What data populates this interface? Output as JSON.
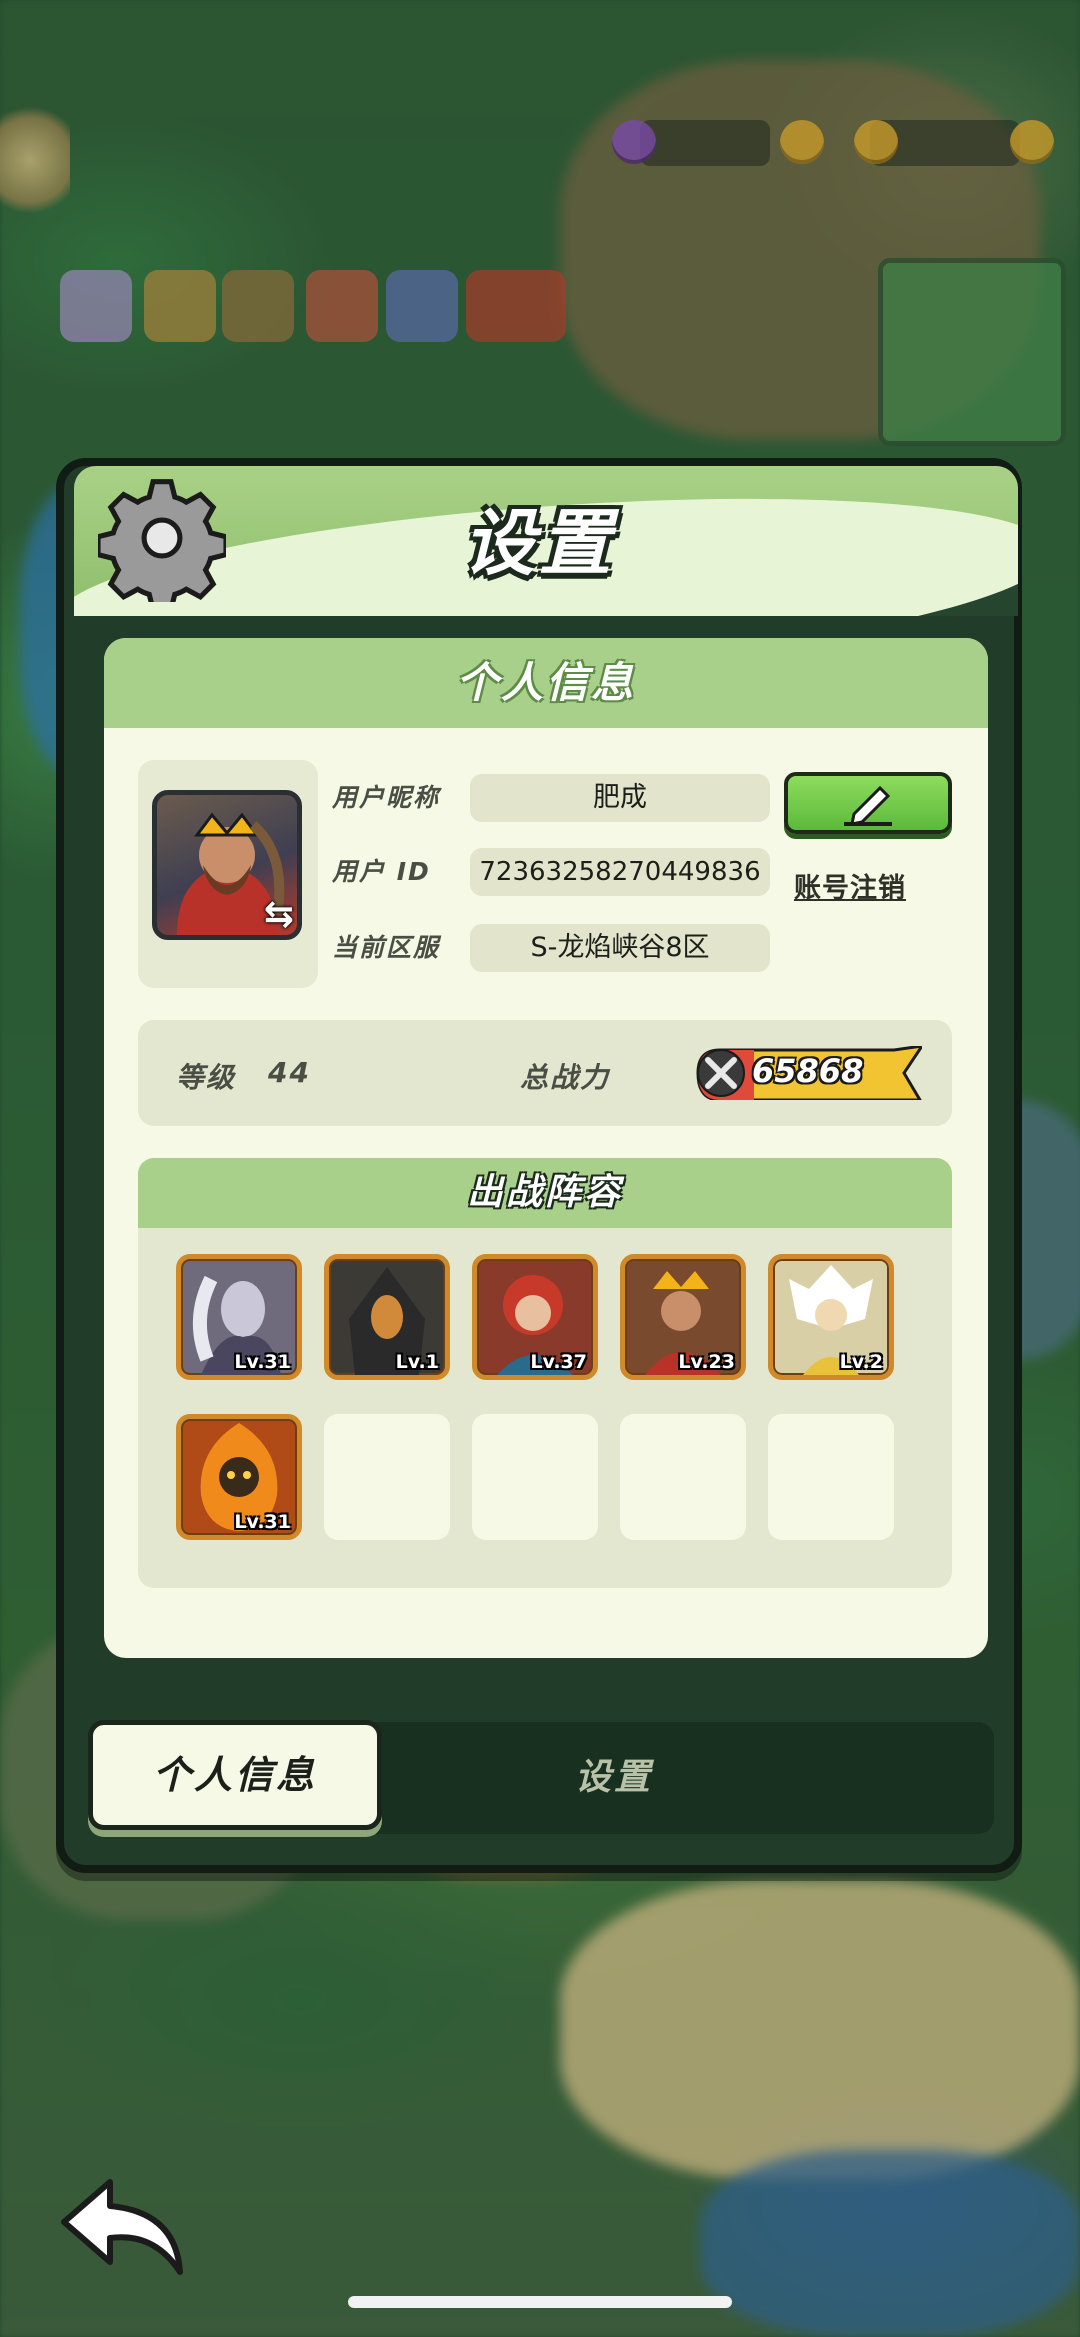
{
  "dialog": {
    "title": "设置",
    "profile_header": "个人信息",
    "labels": {
      "nickname": "用户昵称",
      "user_id": "用户 ID",
      "server": "当前区服"
    },
    "values": {
      "nickname": "肥成",
      "user_id": "7236325827044983­6",
      "server": "S-龙焰峡谷8区"
    },
    "cancel_account": "账号注销",
    "level_label": "等级",
    "level_value": "44",
    "power_label": "总战力",
    "power_value": "65868",
    "lineup_header": "出战阵容",
    "heroes": [
      {
        "level": "Lv.31",
        "color": "#6f6b7c"
      },
      {
        "level": "Lv.1",
        "color": "#3b3a35"
      },
      {
        "level": "Lv.37",
        "color": "#8a3a2a"
      },
      {
        "level": "Lv.23",
        "color": "#7a4a2e"
      },
      {
        "level": "Lv.2",
        "color": "#d9cfa6"
      },
      {
        "level": "Lv.31",
        "color": "#b04a16"
      }
    ]
  },
  "tabs": {
    "profile": "个人信息",
    "settings": "设置"
  },
  "icons": {
    "settings": "gear-icon",
    "edit": "pencil-icon",
    "swap": "swap-icon",
    "power": "crossed-swords-icon",
    "back": "back-arrow-icon"
  },
  "colors": {
    "accent_green": "#8ebe6c",
    "panel_bg": "#213d2a",
    "card_bg": "#f6f9e6",
    "power_badge": "#f2c431"
  }
}
